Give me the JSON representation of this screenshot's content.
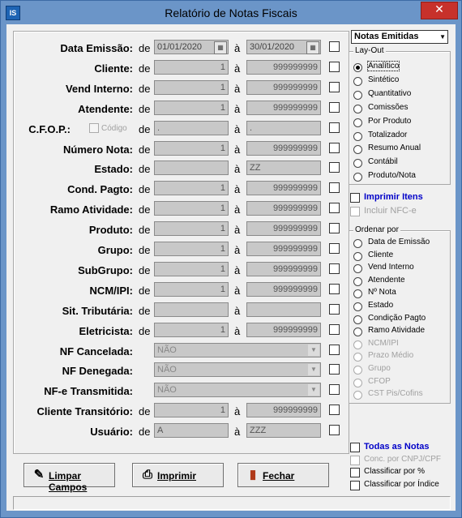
{
  "window": {
    "title": "Relatório de Notas Fiscais",
    "icon_text": "IS",
    "close_glyph": "✕"
  },
  "form": {
    "de": "de",
    "a": "à",
    "cfop_code_label": "Código",
    "rows": [
      {
        "label": "Data Emissão:",
        "from": "01/01/2020",
        "to": "30/01/2020"
      },
      {
        "label": "Cliente:",
        "from": "1",
        "to": "999999999"
      },
      {
        "label": "Vend Interno:",
        "from": "1",
        "to": "999999999"
      },
      {
        "label": "Atendente:",
        "from": "1",
        "to": "999999999"
      },
      {
        "label": "C.F.O.P.:",
        "from": ".",
        "to": "."
      },
      {
        "label": "Número Nota:",
        "from": "1",
        "to": "999999999"
      },
      {
        "label": "Estado:",
        "from": "",
        "to": "ZZ"
      },
      {
        "label": "Cond. Pagto:",
        "from": "1",
        "to": "999999999"
      },
      {
        "label": "Ramo Atividade:",
        "from": "1",
        "to": "999999999"
      },
      {
        "label": "Produto:",
        "from": "1",
        "to": "999999999"
      },
      {
        "label": "Grupo:",
        "from": "1",
        "to": "999999999"
      },
      {
        "label": "SubGrupo:",
        "from": "1",
        "to": "999999999"
      },
      {
        "label": "NCM/IPI:",
        "from": "1",
        "to": "999999999"
      },
      {
        "label": "Sit. Tributária:",
        "from": "",
        "to": ""
      },
      {
        "label": "Eletricista:",
        "from": "1",
        "to": "999999999"
      },
      {
        "label": "NF Cancelada:",
        "value": "NÃO"
      },
      {
        "label": "NF Denegada:",
        "value": "NÃO"
      },
      {
        "label": "NF-e Transmitida:",
        "value": "NÃO"
      },
      {
        "label": "Cliente Transitório:",
        "from": "1",
        "to": "999999999"
      },
      {
        "label": "Usuário:",
        "from": "A",
        "to": "ZZZ"
      }
    ]
  },
  "report_type": {
    "selected": "Notas Emitidas"
  },
  "layout_group": {
    "title": "Lay-Out",
    "options": [
      "Analítico",
      "Sintético",
      "Quantitativo",
      "Comissões",
      "Por Produto",
      "Totalizador",
      "Resumo Anual",
      "Contábil",
      "Produto/Nota"
    ],
    "selected_index": 0
  },
  "imprimir_itens": "Imprimir Itens",
  "incluir_nfce": "Incluir NFC-e",
  "order_group": {
    "title": "Ordenar por",
    "options": [
      "Data de Emissão",
      "Cliente",
      "Vend Interno",
      "Atendente",
      "Nº Nota",
      "Estado",
      "Condição Pagto",
      "Ramo Atividade",
      "NCM/IPI",
      "Prazo Médio",
      "Grupo",
      "CFOP",
      "CST Pis/Cofins"
    ],
    "disabled_from": 8
  },
  "bottom_checks": {
    "todas_notas": "Todas as Notas",
    "conc_cnpj": "Conc. por CNPJ/CPF",
    "classificar_pct": "Classificar por %",
    "classificar_indice": "Classificar por Índice"
  },
  "buttons": {
    "limpar": "Limpar Campos",
    "imprimir": "Imprimir",
    "fechar": "Fechar"
  },
  "icons": {
    "limpar": "eraser-icon",
    "imprimir": "printer-icon",
    "fechar": "door-exit-icon",
    "calendar": "calendar-icon"
  }
}
